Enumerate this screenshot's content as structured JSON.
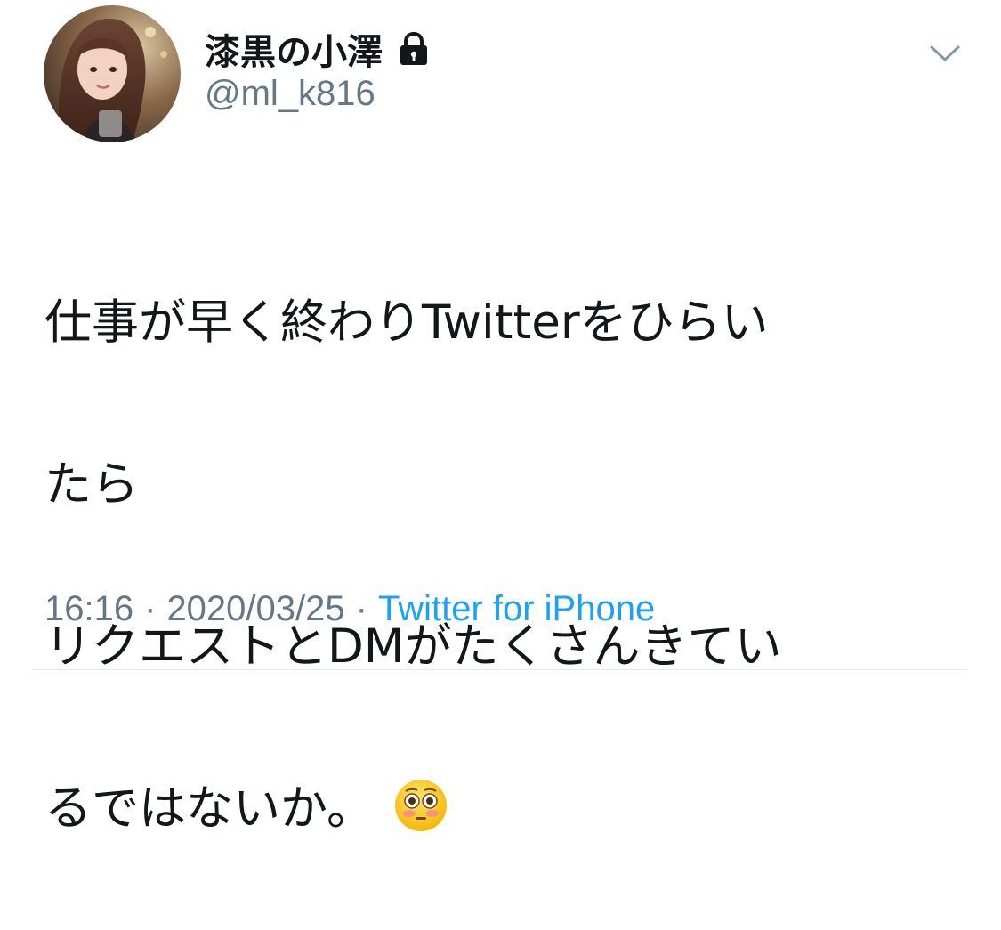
{
  "user": {
    "display_name": "漆黒の小澤",
    "handle": "@ml_k816",
    "protected_icon": "lock-icon",
    "avatar": "profile-photo"
  },
  "menu": {
    "icon": "chevron-down-icon"
  },
  "tweet": {
    "lines": [
      "仕事が早く終わりTwitterをひらい",
      "たら",
      "リクエストとDMがたくさんきてい",
      "るではないか。"
    ],
    "emoji": "flushed-face-emoji"
  },
  "meta": {
    "time": "16:16",
    "separator": "·",
    "date": "2020/03/25",
    "source": "Twitter for iPhone"
  },
  "colors": {
    "text_primary": "#14171a",
    "text_secondary": "#657786",
    "link": "#1da1f2",
    "divider": "#e1e8ed"
  }
}
